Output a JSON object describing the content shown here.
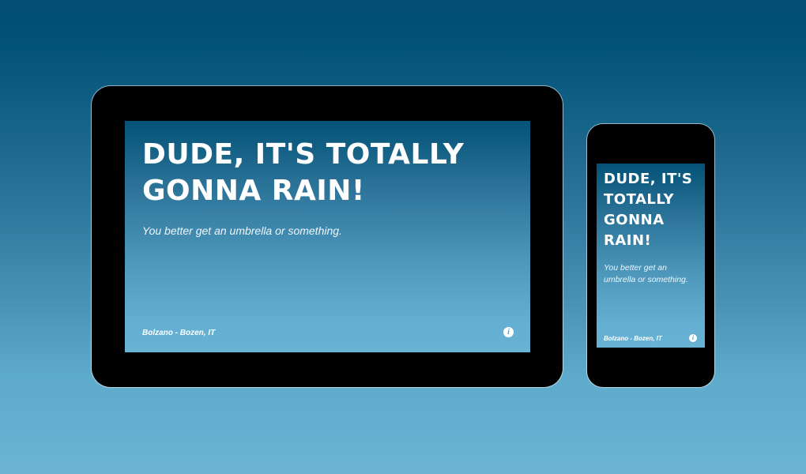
{
  "colors": {
    "background_top": "#024d73",
    "background_bottom": "#6ab3d3",
    "device_body": "#000000",
    "screen_top": "#035277",
    "screen_bottom": "#68b2d4",
    "text": "#ffffff"
  },
  "tablet": {
    "headline": "DUDE, IT'S TOTALLY GONNA RAIN!",
    "subtitle": "You better get an umbrella or something.",
    "location": "Bolzano - Bozen, IT",
    "info_icon": "info-icon",
    "info_glyph": "i"
  },
  "phone": {
    "headline": "DUDE, IT'S TOTALLY GONNA RAIN!",
    "subtitle": "You better get an umbrella or something.",
    "location": "Bolzano - Bozen, IT",
    "info_icon": "info-icon",
    "info_glyph": "i"
  }
}
